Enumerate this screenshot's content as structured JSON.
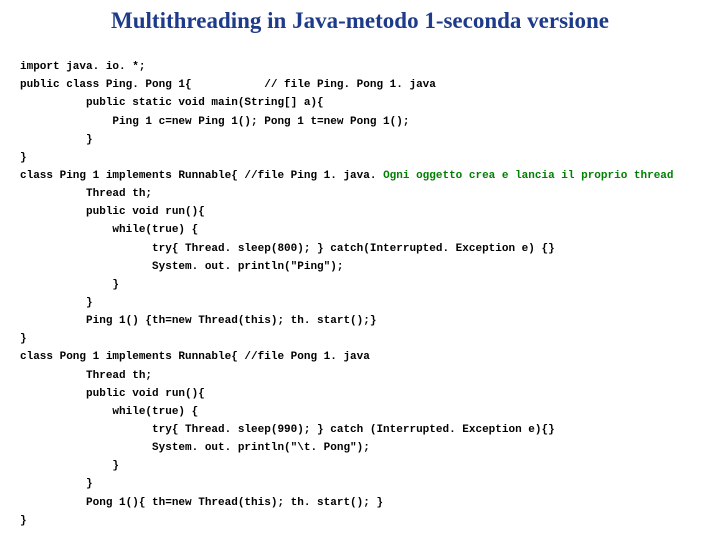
{
  "title": "Multithreading in Java-metodo 1-seconda versione",
  "code": {
    "l01": "import java. io. *;",
    "l02": "public class Ping. Pong 1{           // file Ping. Pong 1. java",
    "l03": "          public static void main(String[] a){",
    "l04": "              Ping 1 c=new Ping 1(); Pong 1 t=new Pong 1();",
    "l05": "          }",
    "l06": "}",
    "l07a": "class Ping 1 implements Runnable{ //file Ping 1. java. ",
    "l07b": "Ogni oggetto crea e lancia il proprio thread",
    "l08": "          Thread th;",
    "l09": "          public void run(){",
    "l10": "              while(true) {",
    "l11": "                    try{ Thread. sleep(800); } catch(Interrupted. Exception e) {}",
    "l12": "                    System. out. println(\"Ping\");",
    "l13": "              }",
    "l14": "          }",
    "l15": "          Ping 1() {th=new Thread(this); th. start();}",
    "l16": "}",
    "l17": "class Pong 1 implements Runnable{ //file Pong 1. java",
    "l18": "          Thread th;",
    "l19": "          public void run(){",
    "l20": "              while(true) {",
    "l21": "                    try{ Thread. sleep(990); } catch (Interrupted. Exception e){}",
    "l22": "                    System. out. println(\"\\t. Pong\");",
    "l23": "              }",
    "l24": "          }",
    "l25": "          Pong 1(){ th=new Thread(this); th. start(); }",
    "l26": "}"
  }
}
